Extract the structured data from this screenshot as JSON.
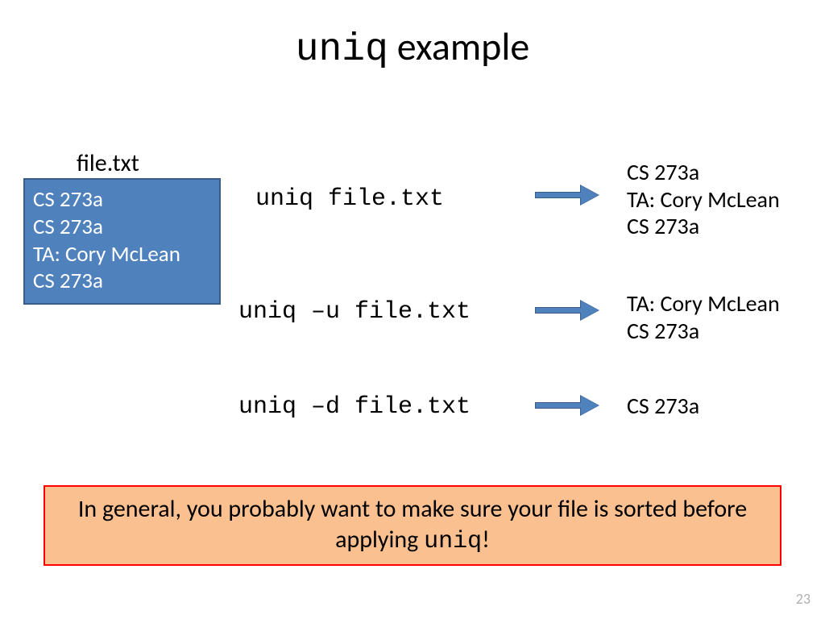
{
  "title_cmd": "uniq",
  "title_rest": " example",
  "file_label": "file.txt",
  "file_lines": {
    "l1": "CS 273a",
    "l2": "CS 273a",
    "l3": "TA: Cory McLean",
    "l4": "CS 273a"
  },
  "commands": {
    "c1": "uniq file.txt",
    "c2": "uniq –u file.txt",
    "c3": "uniq –d file.txt"
  },
  "outputs": {
    "o1": {
      "l1": "CS 273a",
      "l2": "TA: Cory McLean",
      "l3": "CS 273a"
    },
    "o2": {
      "l1": "TA: Cory McLean",
      "l2": "CS 273a"
    },
    "o3": {
      "l1": "CS 273a"
    }
  },
  "note_pre": "In general, you probably want to make sure your file is sorted before applying ",
  "note_cmd": "uniq",
  "note_post": "!",
  "page_number": "23"
}
